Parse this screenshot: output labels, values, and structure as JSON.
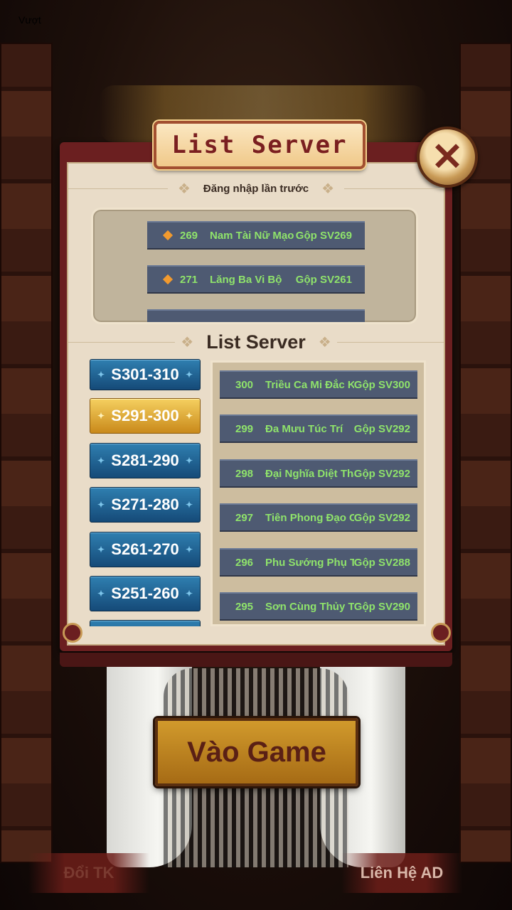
{
  "status_text": "Vượt",
  "dialog": {
    "title": "List Server",
    "close_icon": "close-x-icon",
    "recent_label": "Đăng nhập lần trước",
    "list_label": "List Server"
  },
  "recent_servers": [
    {
      "num": "269",
      "name": "Nam Tài Nữ Mạo",
      "merge": "Gộp SV269"
    },
    {
      "num": "271",
      "name": "Lăng Ba Vi Bộ",
      "merge": "Gộp SV261"
    }
  ],
  "server_groups": [
    {
      "label": "S301-310",
      "active": false
    },
    {
      "label": "S291-300",
      "active": true
    },
    {
      "label": "S281-290",
      "active": false
    },
    {
      "label": "S271-280",
      "active": false
    },
    {
      "label": "S261-270",
      "active": false
    },
    {
      "label": "S251-260",
      "active": false
    }
  ],
  "servers": [
    {
      "num": "300",
      "name": "Triều Ca Mi Đắc Kỷ",
      "merge": "Gộp SV300"
    },
    {
      "num": "299",
      "name": "Đa Mưu Túc Trí",
      "merge": "Gộp SV292"
    },
    {
      "num": "298",
      "name": "Đại Nghĩa Diệt Thân",
      "merge": "Gộp SV292"
    },
    {
      "num": "297",
      "name": "Tiên Phong Đạo Cốt",
      "merge": "Gộp SV292"
    },
    {
      "num": "296",
      "name": "Phu Sướng Phụ Tùy",
      "merge": "Gộp SV288"
    },
    {
      "num": "295",
      "name": "Sơn Cùng Thủy Tận",
      "merge": "Gộp SV290"
    }
  ],
  "buttons": {
    "play": "Vào Game",
    "switch_account": "Đổi TK",
    "contact_admin": "Liên Hệ AD"
  },
  "colors": {
    "frame": "#6b1f20",
    "panel": "#e9dcc8",
    "server_text": "#8fe36b",
    "tab_blue": "#1f6a9c",
    "tab_active": "#e0aa35",
    "diamond": "#f29a2e"
  }
}
